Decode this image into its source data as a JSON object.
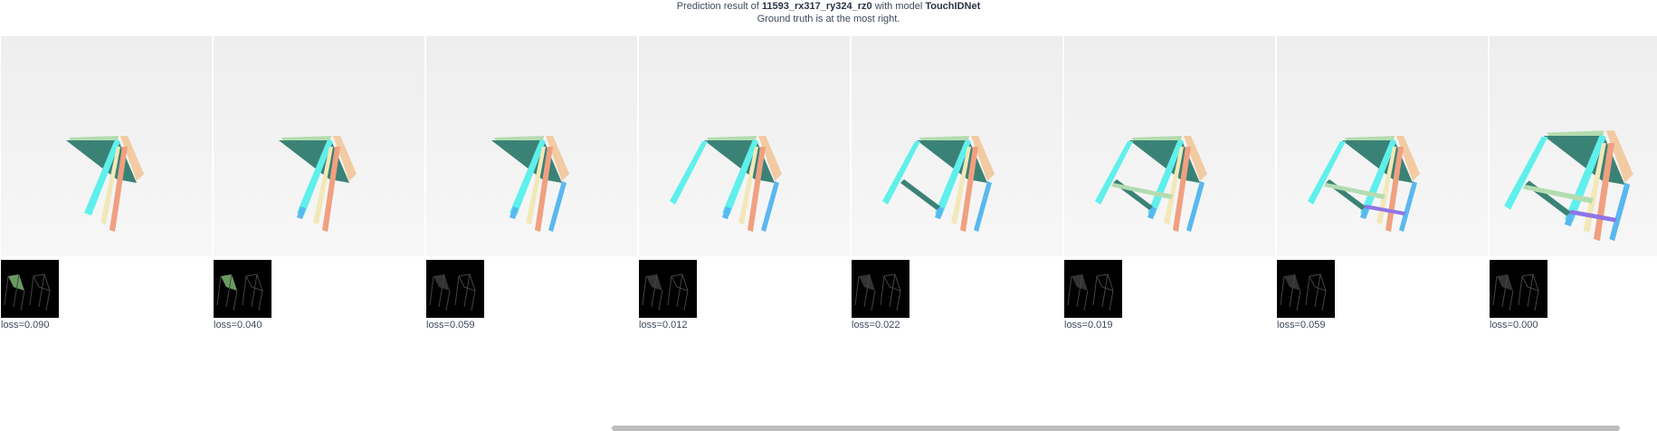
{
  "header": {
    "prefix": "Prediction result of ",
    "sample_id": "11593_rx317_ry324_rz0",
    "middle": " with model ",
    "model": "TouchIDNet",
    "subtitle": "Ground truth is at the most right."
  },
  "panels": [
    {
      "loss": "loss=0.090"
    },
    {
      "loss": "loss=0.040"
    },
    {
      "loss": "loss=0.059"
    },
    {
      "loss": "loss=0.012"
    },
    {
      "loss": "loss=0.022"
    },
    {
      "loss": "loss=0.019"
    },
    {
      "loss": "loss=0.059"
    },
    {
      "loss": "loss=0.000"
    }
  ],
  "colors": {
    "seat": "#3b8276",
    "seat_top": "#b4dcb0",
    "back": "#f2cba2",
    "leg_cyan": "#5ff0ec",
    "leg_pink": "#f0a080",
    "leg_cream": "#f2e8b8",
    "leg_blue": "#5ab8f0",
    "rail_purple": "#8f74e6"
  }
}
